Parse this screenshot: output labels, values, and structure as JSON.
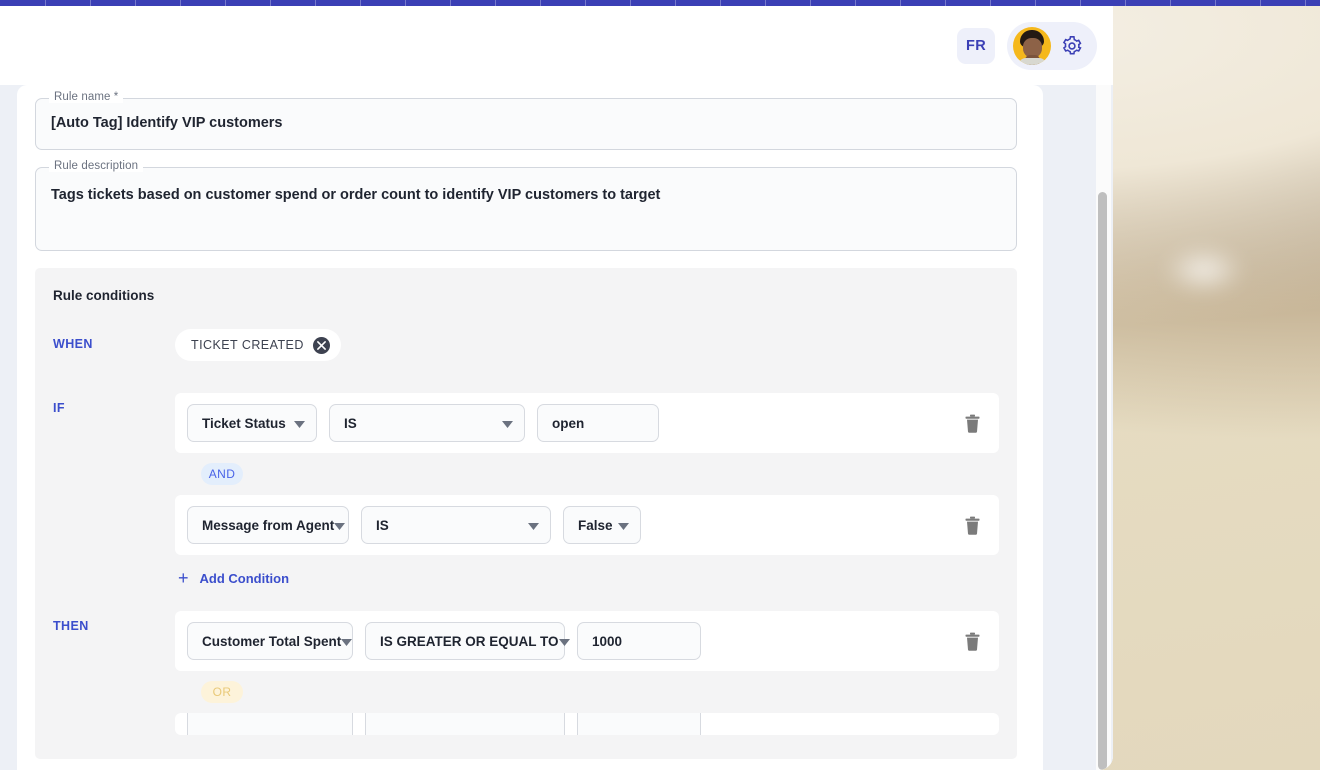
{
  "header": {
    "language_button": "FR",
    "avatar_name": "user-avatar",
    "settings_icon": "gear-icon"
  },
  "form": {
    "rule_name": {
      "label": "Rule name *",
      "value": "[Auto Tag] Identify VIP customers"
    },
    "rule_description": {
      "label": "Rule description",
      "value": "Tags tickets based on customer spend or order count to identify VIP customers to target"
    }
  },
  "conditions": {
    "title": "Rule conditions",
    "when": {
      "label": "WHEN",
      "trigger": "TICKET CREATED",
      "remove_icon": "close-icon"
    },
    "if": {
      "label": "IF",
      "rows": [
        {
          "field": "Ticket Status",
          "operator": "IS",
          "value": "open",
          "value_type": "input",
          "delete_icon": "trash-icon"
        },
        {
          "field": "Message from Agent",
          "operator": "IS",
          "value": "False",
          "value_type": "select",
          "delete_icon": "trash-icon"
        }
      ],
      "joiner": "AND",
      "add_condition": "Add Condition",
      "add_icon": "plus-icon"
    },
    "then": {
      "label": "THEN",
      "rows": [
        {
          "field": "Customer Total Spent",
          "operator": "IS GREATER OR EQUAL TO",
          "value": "1000",
          "value_type": "input",
          "delete_icon": "trash-icon"
        }
      ],
      "joiner": "OR"
    }
  },
  "scrollbar": {
    "name": "vertical-scrollbar"
  }
}
